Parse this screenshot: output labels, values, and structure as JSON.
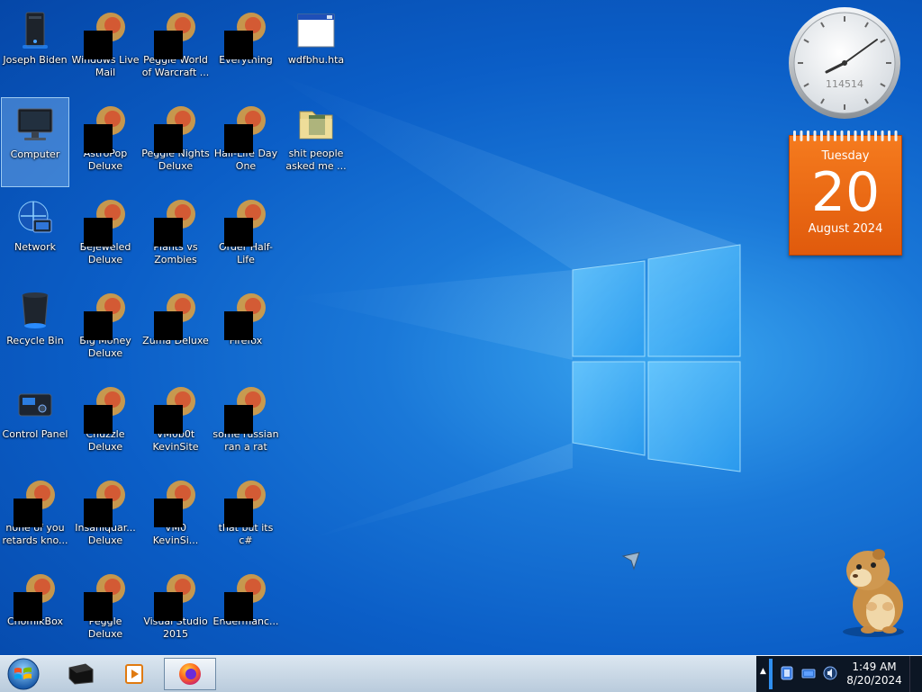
{
  "desktop": {
    "icons": [
      {
        "label": "Joseph Biden",
        "icon": "computer-tower-icon"
      },
      {
        "label": "Computer",
        "icon": "monitor-icon",
        "selected": true
      },
      {
        "label": "Network",
        "icon": "network-globe-icon"
      },
      {
        "label": "Recycle Bin",
        "icon": "recycle-bin-icon"
      },
      {
        "label": "Control Panel",
        "icon": "control-panel-icon"
      },
      {
        "label": "none of you retards kno...",
        "icon": "censored-app-icon"
      },
      {
        "label": "ChomikBox",
        "icon": "censored-app-icon"
      },
      {
        "label": "Windows Live Mail",
        "icon": "censored-app-icon"
      },
      {
        "label": "AstroPop Deluxe",
        "icon": "censored-app-icon"
      },
      {
        "label": "Bejeweled Deluxe",
        "icon": "censored-app-icon"
      },
      {
        "label": "Big Money Deluxe",
        "icon": "censored-app-icon"
      },
      {
        "label": "Chuzzle Deluxe",
        "icon": "censored-app-icon"
      },
      {
        "label": "Insaniquar... Deluxe",
        "icon": "censored-app-icon"
      },
      {
        "label": "Peggle Deluxe",
        "icon": "censored-app-icon"
      },
      {
        "label": "Peggle World of Warcraft ...",
        "icon": "censored-app-icon"
      },
      {
        "label": "Peggle Nights Deluxe",
        "icon": "censored-app-icon"
      },
      {
        "label": "Plants vs Zombies",
        "icon": "censored-app-icon"
      },
      {
        "label": "Zuma Deluxe",
        "icon": "censored-app-icon"
      },
      {
        "label": "VM0b0t KevinSite",
        "icon": "censored-app-icon"
      },
      {
        "label": "VM0 KevinSi...",
        "icon": "censored-app-icon"
      },
      {
        "label": "Visual Studio 2015",
        "icon": "censored-app-icon"
      },
      {
        "label": "Everything",
        "icon": "censored-app-icon"
      },
      {
        "label": "Half-Life Day One",
        "icon": "censored-app-icon"
      },
      {
        "label": "Order Half-Life",
        "icon": "censored-app-icon"
      },
      {
        "label": "Firefox",
        "icon": "censored-app-icon"
      },
      {
        "label": "some russian ran a rat",
        "icon": "censored-app-icon"
      },
      {
        "label": "that but its c#",
        "icon": "censored-app-icon"
      },
      {
        "label": "Endermanc...",
        "icon": "censored-app-icon"
      },
      {
        "label": "wdfbhu.hta",
        "icon": "hta-window-icon"
      },
      {
        "label": "shit people asked me ...",
        "icon": "folder-icon"
      }
    ]
  },
  "gadgets": {
    "clock": {
      "brand_text": "114514",
      "time": "1:49"
    },
    "calendar": {
      "weekday": "Tuesday",
      "day": "20",
      "month_year": "August 2024"
    }
  },
  "taskbar": {
    "start_icon": "windows-logo-icon",
    "pinned": [
      {
        "icon": "terminal-box-icon",
        "active": false
      },
      {
        "icon": "media-player-icon",
        "active": false
      },
      {
        "icon": "firefox-icon",
        "active": true
      }
    ],
    "tray": {
      "icons": [
        "shield-icon",
        "network-icon",
        "volume-icon"
      ],
      "time": "1:49 AM",
      "date": "8/20/2024"
    }
  },
  "colors": {
    "desktop_blue": "#0b5ec7",
    "calendar_orange": "#f0701a",
    "taskbar": "#c8d7e6",
    "tray_dark": "#0c1624"
  }
}
